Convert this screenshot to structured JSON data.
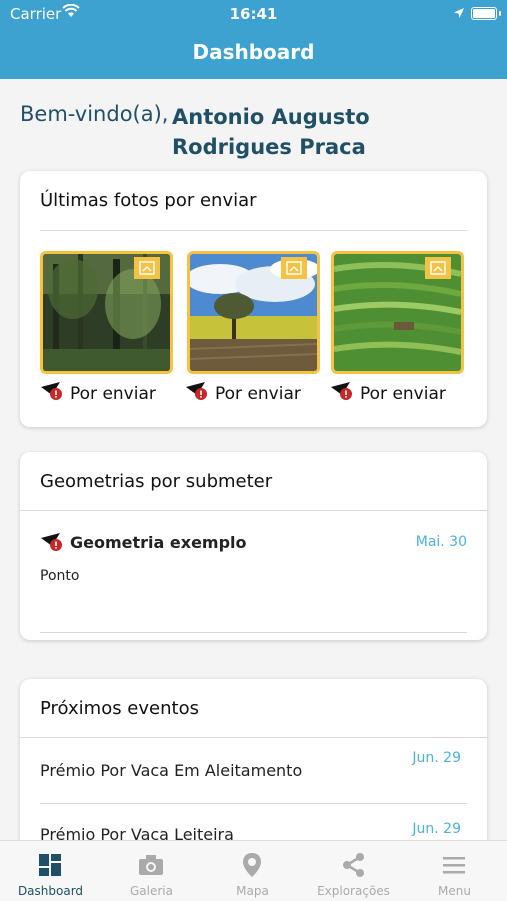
{
  "status": {
    "carrier": "Carrier",
    "time": "16:41"
  },
  "header": {
    "title": "Dashboard"
  },
  "welcome": {
    "greeting": "Bem-vindo(a),",
    "name_line1": "Antonio Augusto",
    "name_line2": "Rodrigues Praca"
  },
  "photos": {
    "title": "Últimas fotos por enviar",
    "items": [
      {
        "scene": "forest",
        "status": "Por enviar"
      },
      {
        "scene": "tree-field",
        "status": "Por enviar"
      },
      {
        "scene": "rice-terraces",
        "status": "Por enviar"
      }
    ]
  },
  "geometries": {
    "title": "Geometrias por submeter",
    "items": [
      {
        "name": "Geometria exemplo",
        "date": "Mai. 30",
        "type": "Ponto"
      }
    ]
  },
  "events": {
    "title": "Próximos eventos",
    "items": [
      {
        "label": "Prémio Por Vaca Em Aleitamento",
        "date": "Jun. 29"
      },
      {
        "label": "Prémio Por Vaca Leiteira",
        "date": "Jun. 29"
      }
    ]
  },
  "tabs": [
    {
      "label": "Dashboard",
      "icon": "dashboard-icon",
      "active": true
    },
    {
      "label": "Galeria",
      "icon": "camera-icon",
      "active": false
    },
    {
      "label": "Mapa",
      "icon": "map-pin-icon",
      "active": false
    },
    {
      "label": "Explorações",
      "icon": "share-icon",
      "active": false
    },
    {
      "label": "Menu",
      "icon": "menu-icon",
      "active": false
    }
  ],
  "colors": {
    "header": "#3da2cf",
    "accent": "#1f5068",
    "date": "#4ab1e3",
    "pending_border": "#f5c242"
  }
}
